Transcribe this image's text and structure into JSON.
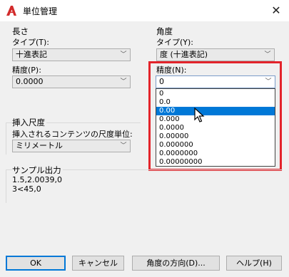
{
  "window": {
    "title": "単位管理",
    "close_glyph": "✕"
  },
  "length": {
    "group_title": "長さ",
    "type_label": "タイプ(T):",
    "type_value": "十進表記",
    "precision_label": "精度(P):",
    "precision_value": "0.0000"
  },
  "angle": {
    "group_title": "角度",
    "type_label": "タイプ(Y):",
    "type_value": "度 (十進表記)",
    "precision_label": "精度(N):",
    "precision_value": "0",
    "options": [
      "0",
      "0.0",
      "0.00",
      "0.000",
      "0.0000",
      "0.00000",
      "0.000000",
      "0.0000000",
      "0.00000000"
    ],
    "selected_option": "0.00"
  },
  "insertion": {
    "group_title": "挿入尺度",
    "label": "挿入されるコンテンツの尺度単位:",
    "value": "ミリメートル"
  },
  "sample": {
    "group_title": "サンプル出力",
    "line1": "1.5,2.0039,0",
    "line2": "3<45,0"
  },
  "buttons": {
    "ok": "OK",
    "cancel": "キャンセル",
    "direction": "角度の方向(D)...",
    "help": "ヘルプ(H)"
  },
  "colors": {
    "accent": "#0078d7",
    "highlight_box": "#e3242b",
    "app_icon": "#d22b2b"
  },
  "icons": {
    "app": "autocad-a-icon",
    "close": "close-icon",
    "dropdown": "chevron-down-icon",
    "cursor": "mouse-pointer-icon"
  }
}
